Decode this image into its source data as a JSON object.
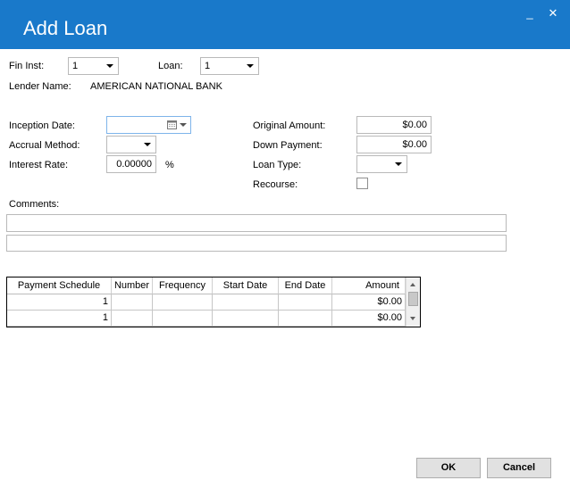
{
  "window": {
    "title": "Add Loan",
    "minimize_label": "_",
    "close_label": "✕"
  },
  "form": {
    "fin_inst": {
      "label": "Fin Inst:",
      "value": "1"
    },
    "loan": {
      "label": "Loan:",
      "value": "1"
    },
    "lender_name": {
      "label": "Lender Name:",
      "value": "AMERICAN NATIONAL BANK"
    },
    "inception_date": {
      "label": "Inception Date:",
      "value": ""
    },
    "accrual_method": {
      "label": "Accrual Method:",
      "value": ""
    },
    "interest_rate": {
      "label": "Interest Rate:",
      "value": "0.00000",
      "unit": "%"
    },
    "original_amount": {
      "label": "Original Amount:",
      "value": "$0.00"
    },
    "down_payment": {
      "label": "Down Payment:",
      "value": "$0.00"
    },
    "loan_type": {
      "label": "Loan Type:",
      "value": ""
    },
    "recourse": {
      "label": "Recourse:",
      "checked": false
    },
    "comments": {
      "label": "Comments:",
      "line1": "",
      "line2": ""
    }
  },
  "grid": {
    "columns": [
      "Payment Schedule",
      "Number",
      "Frequency",
      "Start Date",
      "End Date",
      "Amount"
    ],
    "rows": [
      {
        "payment_schedule": "1",
        "number": "",
        "frequency": "",
        "start_date": "",
        "end_date": "",
        "amount": "$0.00"
      },
      {
        "payment_schedule": "1",
        "number": "",
        "frequency": "",
        "start_date": "",
        "end_date": "",
        "amount": "$0.00"
      }
    ]
  },
  "buttons": {
    "ok": "OK",
    "cancel": "Cancel"
  },
  "colors": {
    "titlebar": "#1979ca",
    "focus_border": "#7eb4ea"
  }
}
